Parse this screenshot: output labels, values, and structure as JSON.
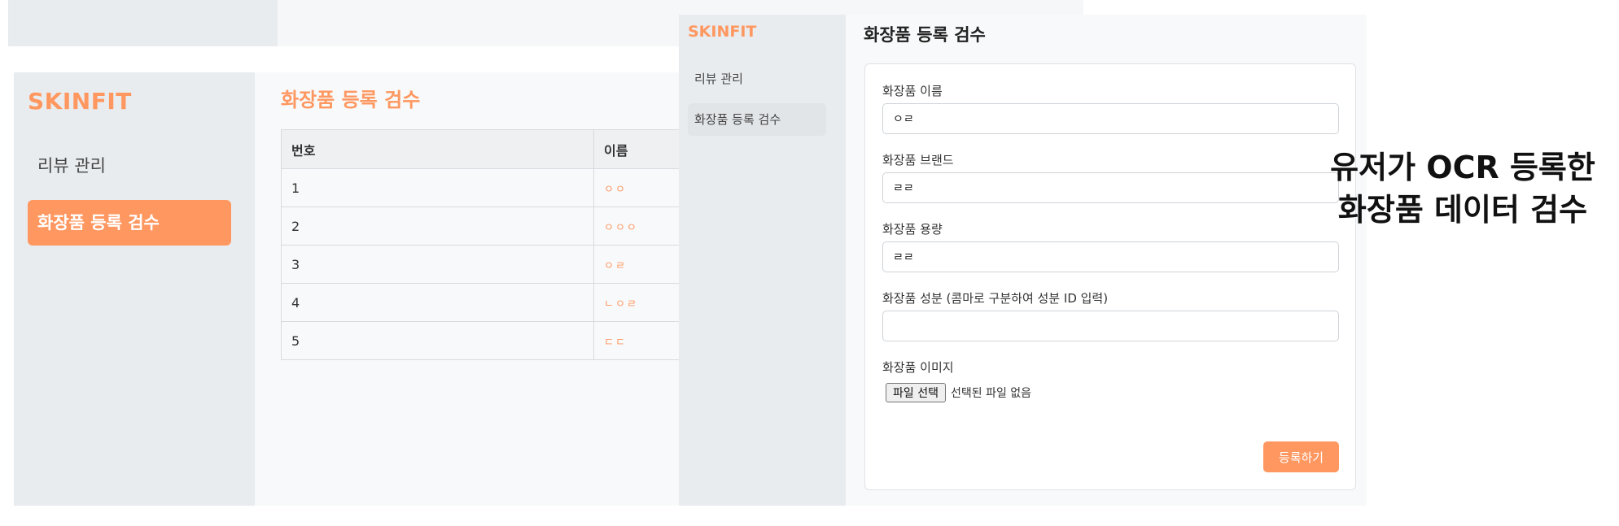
{
  "list_view": {
    "logo": "SKINFIT",
    "nav": {
      "review": "리뷰 관리",
      "register": "화장품 등록 검수"
    },
    "title": "화장품 등록 검수",
    "table": {
      "headers": [
        "번호",
        "이름"
      ],
      "rows": [
        [
          "1",
          "ㅇㅇ"
        ],
        [
          "2",
          "ㅇㅇㅇ"
        ],
        [
          "3",
          "ㅇㄹ"
        ],
        [
          "4",
          "ㄴㅇㄹ"
        ],
        [
          "5",
          "ㄷㄷ"
        ]
      ]
    }
  },
  "form_view": {
    "logo": "SKINFIT",
    "nav": {
      "review": "리뷰 관리",
      "register": "화장품 등록 검수"
    },
    "title": "화장품 등록 검수",
    "fields": {
      "name": {
        "label": "화장품 이름",
        "value": "ㅇㄹ"
      },
      "brand": {
        "label": "화장품 브랜드",
        "value": "ㄹㄹ"
      },
      "volume": {
        "label": "화장품 용량",
        "value": "ㄹㄹ"
      },
      "ingredients": {
        "label": "화장품 성분 (콤마로 구분하여 성분 ID 입력)",
        "value": ""
      },
      "image": {
        "label": "화장품 이미지",
        "button": "파일 선택",
        "status": "선택된 파일 없음"
      }
    },
    "submit": "등록하기"
  },
  "caption": {
    "line1": "유저가 OCR 등록한",
    "line2": "화장품 데이터 검수"
  },
  "colors": {
    "accent": "#ff9760",
    "sidebar": "#e9ecef",
    "page": "#f8f9fa"
  }
}
